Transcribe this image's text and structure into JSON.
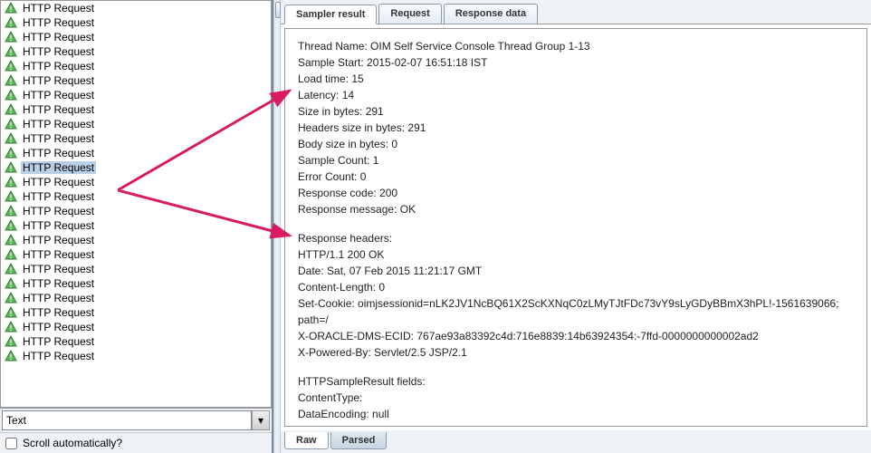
{
  "tree": {
    "items": [
      {
        "label": "HTTP Request",
        "selected": false
      },
      {
        "label": "HTTP Request",
        "selected": false
      },
      {
        "label": "HTTP Request",
        "selected": false
      },
      {
        "label": "HTTP Request",
        "selected": false
      },
      {
        "label": "HTTP Request",
        "selected": false
      },
      {
        "label": "HTTP Request",
        "selected": false
      },
      {
        "label": "HTTP Request",
        "selected": false
      },
      {
        "label": "HTTP Request",
        "selected": false
      },
      {
        "label": "HTTP Request",
        "selected": false
      },
      {
        "label": "HTTP Request",
        "selected": false
      },
      {
        "label": "HTTP Request",
        "selected": false
      },
      {
        "label": "HTTP Request",
        "selected": true
      },
      {
        "label": "HTTP Request",
        "selected": false
      },
      {
        "label": "HTTP Request",
        "selected": false
      },
      {
        "label": "HTTP Request",
        "selected": false
      },
      {
        "label": "HTTP Request",
        "selected": false
      },
      {
        "label": "HTTP Request",
        "selected": false
      },
      {
        "label": "HTTP Request",
        "selected": false
      },
      {
        "label": "HTTP Request",
        "selected": false
      },
      {
        "label": "HTTP Request",
        "selected": false
      },
      {
        "label": "HTTP Request",
        "selected": false
      },
      {
        "label": "HTTP Request",
        "selected": false
      },
      {
        "label": "HTTP Request",
        "selected": false
      },
      {
        "label": "HTTP Request",
        "selected": false
      },
      {
        "label": "HTTP Request",
        "selected": false
      }
    ]
  },
  "dropdown": {
    "value": "Text"
  },
  "scroll_checkbox": {
    "label": "Scroll automatically?"
  },
  "tabs_top": [
    {
      "label": "Sampler result",
      "active": true
    },
    {
      "label": "Request",
      "active": false
    },
    {
      "label": "Response data",
      "active": false
    }
  ],
  "result": {
    "lines1": [
      "Thread Name: OIM Self Service Console Thread Group 1-13",
      "Sample Start: 2015-02-07 16:51:18 IST",
      "Load time: 15",
      "Latency: 14",
      "Size in bytes: 291",
      "Headers size in bytes: 291",
      "Body size in bytes: 0",
      "Sample Count: 1",
      "Error Count: 0",
      "Response code: 200",
      "Response message: OK"
    ],
    "lines2": [
      "Response headers:",
      "HTTP/1.1 200 OK",
      "Date: Sat, 07 Feb 2015 11:21:17 GMT",
      "Content-Length: 0",
      "Set-Cookie: oimjsessionid=nLK2JV1NcBQ61X2ScKXNqC0zLMyTJtFDc73vY9sLyGDyBBmX3hPL!-1561639066; path=/",
      "X-ORACLE-DMS-ECID: 767ae93a83392c4d:716e8839:14b63924354:-7ffd-0000000000002ad2",
      "X-Powered-By: Servlet/2.5 JSP/2.1"
    ],
    "lines3": [
      "HTTPSampleResult fields:",
      "ContentType:",
      "DataEncoding: null"
    ]
  },
  "tabs_bottom": [
    {
      "label": "Raw",
      "active": true
    },
    {
      "label": "Parsed",
      "active": false
    }
  ]
}
